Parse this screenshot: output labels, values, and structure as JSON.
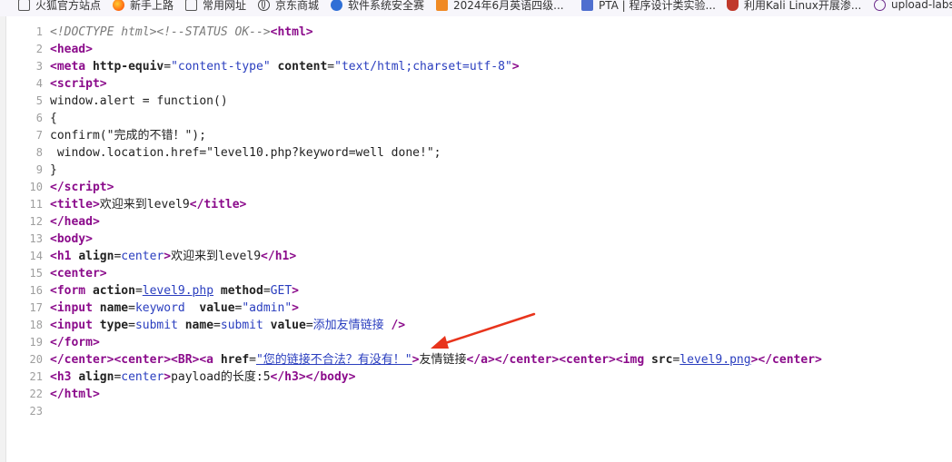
{
  "bookmarks": [
    {
      "label": "火狐官方站点",
      "icon": "folder-icon"
    },
    {
      "label": "新手上路",
      "icon": "firefox-icon"
    },
    {
      "label": "常用网址",
      "icon": "folder-icon"
    },
    {
      "label": "京东商城",
      "icon": "globe-icon"
    },
    {
      "label": "软件系统安全赛",
      "icon": "gear-icon"
    },
    {
      "label": "2024年6月英语四级...",
      "icon": "document-icon"
    },
    {
      "label": "PTA | 程序设计类实验...",
      "icon": "pta-icon"
    },
    {
      "label": "利用Kali Linux开展渗...",
      "icon": "kali-icon"
    },
    {
      "label": "upload-labs",
      "icon": "globe-icon"
    }
  ],
  "source": {
    "line_numbers": [
      "1",
      "2",
      "3",
      "4",
      "5",
      "6",
      "7",
      "8",
      "9",
      "10",
      "11",
      "12",
      "13",
      "14",
      "15",
      "16",
      "17",
      "18",
      "19",
      "20",
      "21",
      "22",
      "23"
    ],
    "doctype": "<!DOCTYPE html>",
    "status_comment": "<!--STATUS OK-->",
    "meta_http_equiv": "content-type",
    "meta_content": "text/html;charset=utf-8",
    "script_line_1": "window.alert = function()",
    "script_line_2": "{",
    "script_line_3": "confirm(\"完成的不错！\");",
    "script_line_4": " window.location.href=\"level10.php?keyword=well done!\";",
    "script_line_5": "}",
    "title_text": "欢迎来到level9",
    "h1_align": "center",
    "h1_text": "欢迎来到level9",
    "form_action": "level9.php",
    "form_method": "GET",
    "input1_name": "keyword",
    "input1_value": "\"admin\"",
    "input2_type": "submit",
    "input2_name": "submit",
    "input2_value": "添加友情链接",
    "link_href": "\"您的链接不合法？有没有！\"",
    "link_text": "友情链接",
    "img_src": "level9.png",
    "h3_align": "center",
    "h3_text": "payload的长度:5"
  },
  "annotation": {
    "color": "#e8341c"
  }
}
